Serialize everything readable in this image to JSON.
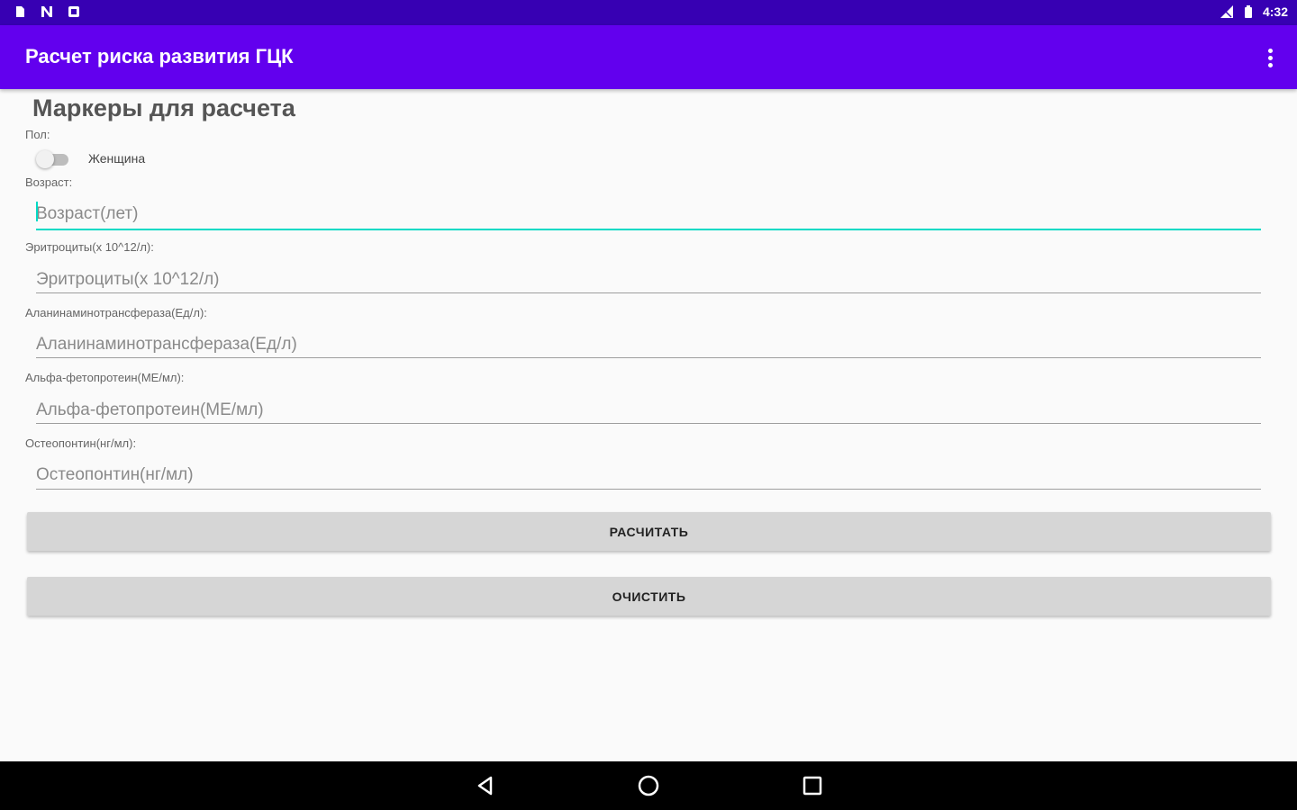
{
  "status_bar": {
    "time": "4:32",
    "left_icons": [
      "sd-card-icon",
      "n-notification-icon",
      "record-icon"
    ],
    "right_icons": [
      "signal-icon",
      "battery-icon"
    ]
  },
  "app_bar": {
    "title": "Расчет риска развития ГЦК",
    "overflow_icon": "more-vert-icon"
  },
  "form": {
    "section_title": "Маркеры для расчета",
    "sex_label": "Пол:",
    "sex_switch_text": "Женщина",
    "sex_switch_on": false,
    "age_label": "Возраст:",
    "age_placeholder": "Возраст(лет)",
    "rbc_label": "Эритроциты(x 10^12/л):",
    "rbc_placeholder": "Эритроциты(x 10^12/л)",
    "alt_label": "Аланинаминотрансфераза(Ед/л):",
    "alt_placeholder": "Аланинаминотрансфераза(Ед/л)",
    "afp_label": "Альфа-фетопротеин(МЕ/мл):",
    "afp_placeholder": "Альфа-фетопротеин(МЕ/мл)",
    "opn_label": "Остеопонтин(нг/мл):",
    "opn_placeholder": "Остеопонтин(нг/мл)"
  },
  "buttons": {
    "calculate": "РАСЧИТАТЬ",
    "clear": "ОЧИСТИТЬ"
  },
  "colors": {
    "status_bar": "#3700b3",
    "app_bar": "#6200ee",
    "accent": "#03dac5"
  },
  "nav_bar": {
    "icons": [
      "back-icon",
      "home-icon",
      "recents-icon"
    ]
  }
}
